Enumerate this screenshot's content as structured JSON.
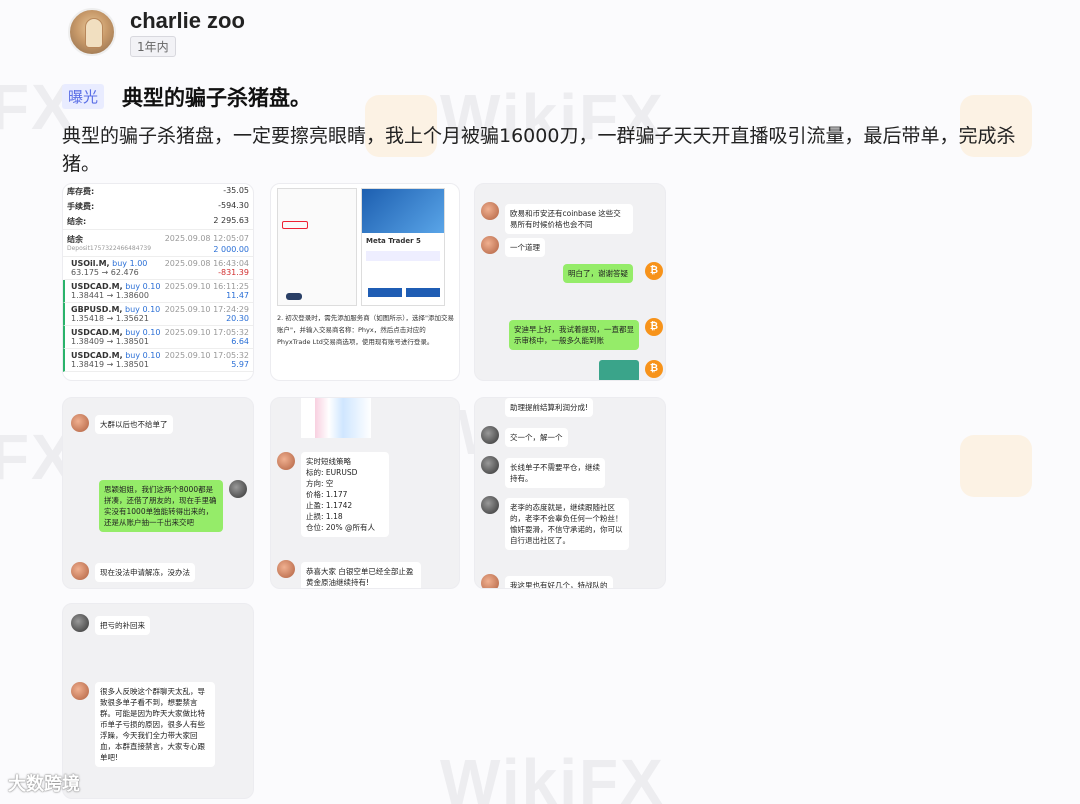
{
  "author": {
    "name": "charlie zoo",
    "time": "1年内"
  },
  "post": {
    "tag": "曝光",
    "title": "典型的骗子杀猪盘。",
    "body": "典型的骗子杀猪盘，一定要擦亮眼睛，我上个月被骗16000刀，一群骗子天天开直播吸引流量，最后带单，完成杀猪。"
  },
  "watermarks": {
    "wikifx": "WikiFX",
    "fx": "FX",
    "footer": "大数跨境"
  },
  "img1": {
    "summary": [
      {
        "label": "库存费:",
        "value": "-35.05"
      },
      {
        "label": "手续费:",
        "value": "-594.30"
      },
      {
        "label": "结余:",
        "value": "2 295.63"
      }
    ],
    "balance_label": "结余",
    "balance_sub": "Deposit1757322466484739",
    "balance_date": "2025.09.08 12:05:07",
    "balance_value": "2 000.00",
    "trades": [
      {
        "sym": "USOil.M,",
        "side": "buy 1.00",
        "prices": "63.175 → 62.476",
        "date": "2025.09.08 16:43:04",
        "pl": "-831.39"
      },
      {
        "sym": "USDCAD.M,",
        "side": "buy 0.10",
        "prices": "1.38441 → 1.38600",
        "date": "2025.09.10 16:11:25",
        "pl": "11.47"
      },
      {
        "sym": "GBPUSD.M,",
        "side": "buy 0.10",
        "prices": "1.35418 → 1.35621",
        "date": "2025.09.10 17:24:29",
        "pl": "20.30"
      },
      {
        "sym": "USDCAD.M,",
        "side": "buy 0.10",
        "prices": "1.38409 → 1.38501",
        "date": "2025.09.10 17:05:32",
        "pl": "6.64"
      },
      {
        "sym": "USDCAD.M,",
        "side": "buy 0.10",
        "prices": "1.38419 → 1.38501",
        "date": "2025.09.10 17:05:32",
        "pl": "5.97"
      }
    ]
  },
  "img2": {
    "app_title": "Meta Trader 5",
    "caption": "2. 初次登录时，需先添加服务商（如图所示），选择\"添加交易账户\"，并输入交易商名称：Phyx，然后点击对应的PhyxTrade Ltd交易商选项，使用现有账号进行登录。"
  },
  "img3": {
    "m1": "欧易和币安还有coinbase 这些交易所有时候价格也会不同",
    "m2": "一个道理",
    "m3": "明白了，谢谢答疑",
    "m4": "安迪早上好，我试着提现，一直都显示审核中，一般多久能到账"
  },
  "img4": {
    "m1": "大群以后也不给单了",
    "m2": "思颖姐姐，我们这两个8000都是拼凑，还借了朋友的，现在手里确实没有1000单独能转得出来的，还是从账户抽一千出来交吧",
    "m3": "现在没法申请解冻，没办法"
  },
  "img5": {
    "lines": [
      "实时短线策略",
      "标的:  EURUSD",
      "方向:  空",
      "价格:  1.177",
      "止盈:  1.1742",
      "止损:  1.18",
      "仓位:  20% @所有人"
    ],
    "m2": "恭喜大家  白银空单已经全部止盈     黄金原油继续持有!"
  },
  "img6": {
    "m0": "助理提前结算利润分成!",
    "m1": "交一个，解一个",
    "m2": "长线单子不需要平仓，继续持有。",
    "m3": "老李的态度就是，继续跟随社区的，老李不会辜负任何一个粉丝！愉奸耍滑，不信守承诺的，你可以自行退出社区了。",
    "m4": "我这里也有好几个，特战队的"
  },
  "img7": {
    "m1": "把亏的补回来",
    "m2": "很多人反映这个群聊天太乱，导致很多单子看不到，想要禁言群。可能是因为昨天大家做比特币单子亏损的原因，很多人有些浮躁，今天我们全力带大家回血，本群直接禁言，大家专心跟单吧!"
  }
}
